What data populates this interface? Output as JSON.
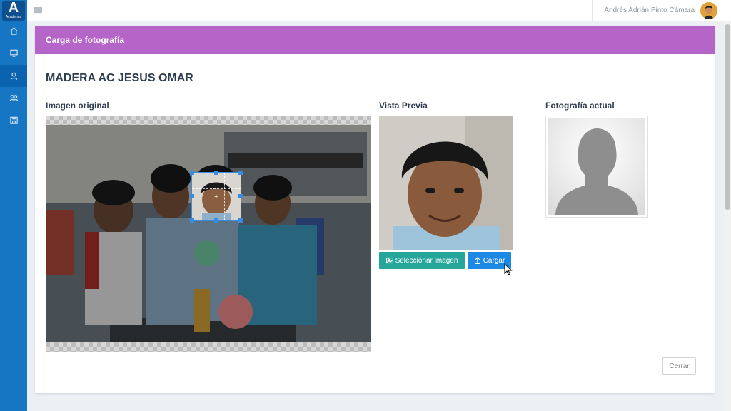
{
  "app": {
    "logo_letter": "A",
    "logo_caption": "Academia"
  },
  "sidebar": {
    "items": [
      {
        "icon": "home-icon"
      },
      {
        "icon": "presentation-icon"
      },
      {
        "icon": "user-icon",
        "active": true
      },
      {
        "icon": "group-icon"
      },
      {
        "icon": "building-icon"
      }
    ]
  },
  "topbar": {
    "user_name": "Andrés Adrián Pinto Cámara"
  },
  "modal": {
    "title": "Carga de fotografía",
    "student_name": "MADERA AC JESUS OMAR",
    "original_title": "Imagen original",
    "preview_title": "Vista Previa",
    "current_title": "Fotografía actual",
    "select_button": "Seleccionar imagen",
    "upload_button": "Cargar",
    "close_button": "Cerrar"
  },
  "colors": {
    "sidebar": "#1676c4",
    "header": "#b565c7",
    "select": "#26a69a",
    "upload": "#1e88e5"
  }
}
